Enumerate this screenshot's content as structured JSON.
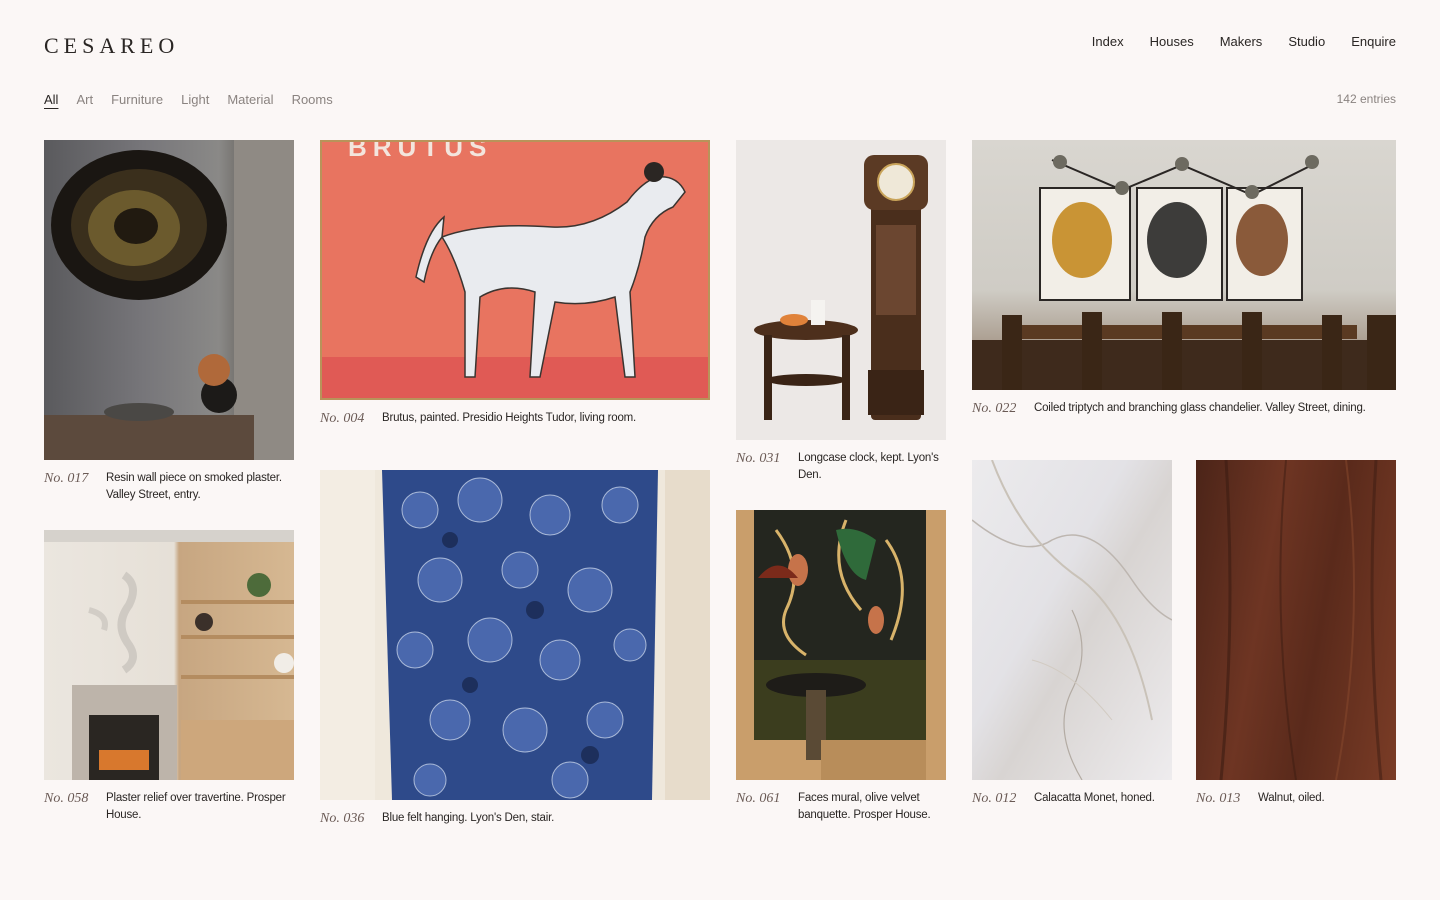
{
  "brand": {
    "logo": "CESAREO"
  },
  "nav": {
    "items": [
      "Index",
      "Houses",
      "Makers",
      "Studio",
      "Enquire"
    ]
  },
  "filters": {
    "items": [
      "All",
      "Art",
      "Furniture",
      "Light",
      "Material",
      "Rooms"
    ],
    "active": "All",
    "entries_count": "142 entries"
  },
  "entries": [
    {
      "no": "No. 017",
      "caption": "Resin wall piece on smoked plaster. Valley Street, entry."
    },
    {
      "no": "No. 004",
      "caption": "Brutus, painted. Presidio Heights Tudor, living room.",
      "art_text": "BRUTUS"
    },
    {
      "no": "No. 031",
      "caption": "Longcase clock, kept. Lyon's Den."
    },
    {
      "no": "No. 022",
      "caption": "Coiled triptych and branching glass chandelier. Valley Street, dining."
    },
    {
      "no": "No. 058",
      "caption": "Plaster relief over travertine. Prosper House."
    },
    {
      "no": "No. 036",
      "caption": "Blue felt hanging. Lyon's Den, stair."
    },
    {
      "no": "No. 061",
      "caption": "Faces mural, olive velvet banquette. Prosper House."
    },
    {
      "no": "No. 012",
      "caption": "Calacatta Monet, honed."
    },
    {
      "no": "No. 013",
      "caption": "Walnut, oiled."
    }
  ]
}
